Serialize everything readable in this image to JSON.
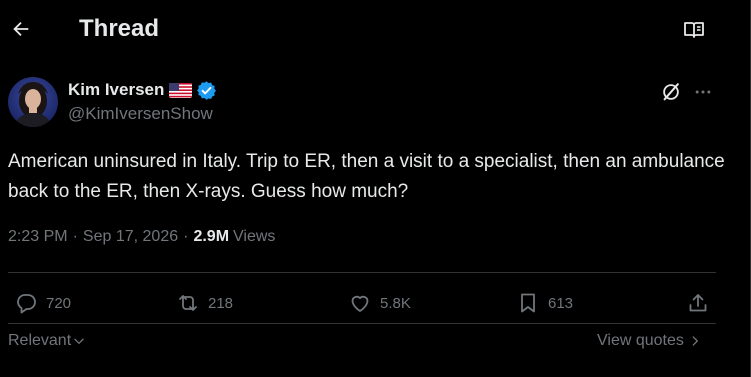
{
  "header": {
    "title": "Thread",
    "back_icon": "arrow-left-icon",
    "reader_icon": "open-book-icon"
  },
  "author": {
    "name": "Kim Iversen",
    "handle": "@KimIversenShow",
    "flag_icon": "us-flag-icon",
    "verified_icon": "verified-badge-icon",
    "verified_color": "#1d9bf0"
  },
  "post": {
    "text": "American uninsured in Italy. Trip to ER, then a visit to a specialist, then an ambulance back to the ER, then X-rays. Guess how much?",
    "time": "2:23 PM",
    "date": "Sep 17, 2026",
    "views_count": "2.9M",
    "views_label": "Views"
  },
  "actions": {
    "replies": "720",
    "reposts": "218",
    "likes": "5.8K",
    "bookmarks": "613"
  },
  "footer": {
    "sort_label": "Relevant",
    "view_quotes_label": "View quotes"
  },
  "colors": {
    "background": "#000000",
    "text_primary": "#e7e9ea",
    "text_secondary": "#71767b",
    "divider": "#2f3336"
  }
}
